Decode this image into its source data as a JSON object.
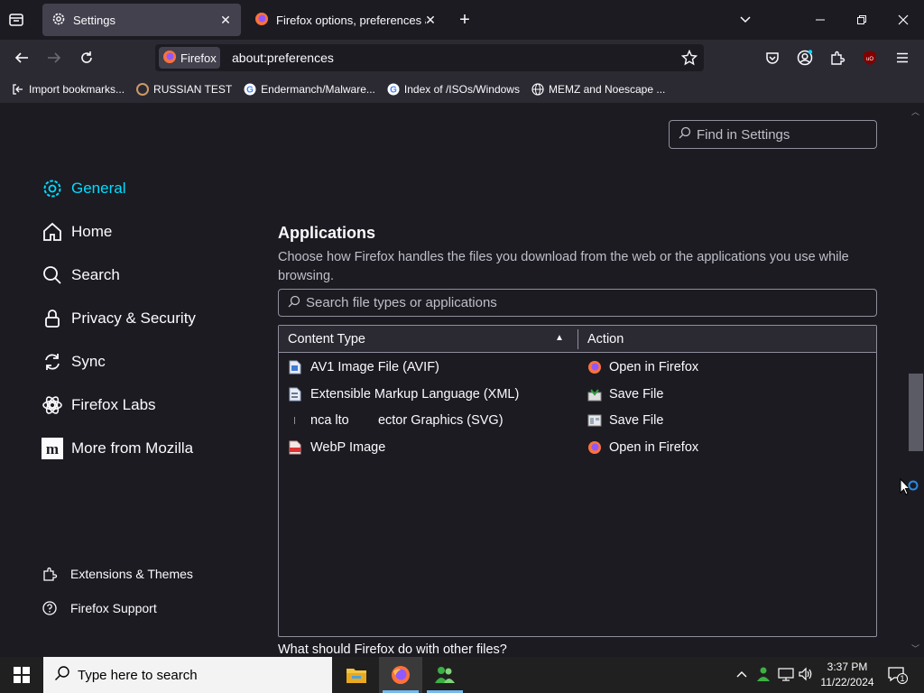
{
  "tabs": [
    {
      "label": "Settings",
      "active": true
    },
    {
      "label": "Firefox options, preferences and",
      "active": false
    }
  ],
  "navbar": {
    "identity_label": "Firefox",
    "url": "about:preferences"
  },
  "bookmarks": [
    {
      "label": "Import bookmarks...",
      "icon": "import-icon"
    },
    {
      "label": "RUSSIAN TEST",
      "icon": "web-icon"
    },
    {
      "label": "Endermanch/Malware...",
      "icon": "google-icon"
    },
    {
      "label": "Index of /ISOs/Windows",
      "icon": "google-icon"
    },
    {
      "label": "MEMZ and Noescape ...",
      "icon": "globe-icon"
    }
  ],
  "search": {
    "placeholder": "Find in Settings"
  },
  "sidebar": {
    "categories": [
      {
        "label": "General",
        "icon": "gear-icon",
        "selected": true
      },
      {
        "label": "Home",
        "icon": "home-icon"
      },
      {
        "label": "Search",
        "icon": "search-icon"
      },
      {
        "label": "Privacy & Security",
        "icon": "lock-icon"
      },
      {
        "label": "Sync",
        "icon": "sync-icon"
      },
      {
        "label": "Firefox Labs",
        "icon": "labs-icon"
      },
      {
        "label": "More from Mozilla",
        "icon": "mozilla-icon"
      }
    ],
    "footer": [
      {
        "label": "Extensions & Themes",
        "icon": "puzzle-icon"
      },
      {
        "label": "Firefox Support",
        "icon": "help-icon"
      }
    ]
  },
  "applications": {
    "title": "Applications",
    "description": "Choose how Firefox handles the files you download from the web or the applications you use while browsing.",
    "filter_placeholder": "Search file types or applications",
    "columns": {
      "type": "Content Type",
      "action": "Action"
    },
    "rows": [
      {
        "type": "AV1 Image File (AVIF)",
        "action": "Open in Firefox",
        "type_icon": "file-icon",
        "action_icon": "firefox-icon"
      },
      {
        "type": "Extensible Markup Language (XML)",
        "action": "Save File",
        "type_icon": "xml-file-icon",
        "action_icon": "save-file-icon"
      },
      {
        "type": "nca lto        ector Graphics (SVG)",
        "action": "Save File",
        "type_icon": "svg-file-icon",
        "action_icon": "save-file-icon"
      },
      {
        "type": "WebP Image",
        "action": "Open in Firefox",
        "type_icon": "pdf-file-icon",
        "action_icon": "firefox-icon"
      }
    ],
    "other_question": "What should Firefox do with other files?"
  },
  "taskbar": {
    "search_placeholder": "Type here to search",
    "time": "3:37 PM",
    "date": "11/22/2024",
    "notification_count": "1"
  },
  "colors": {
    "accent": "#00ddff",
    "background": "#1c1b22",
    "toolbar": "#2b2a33"
  }
}
